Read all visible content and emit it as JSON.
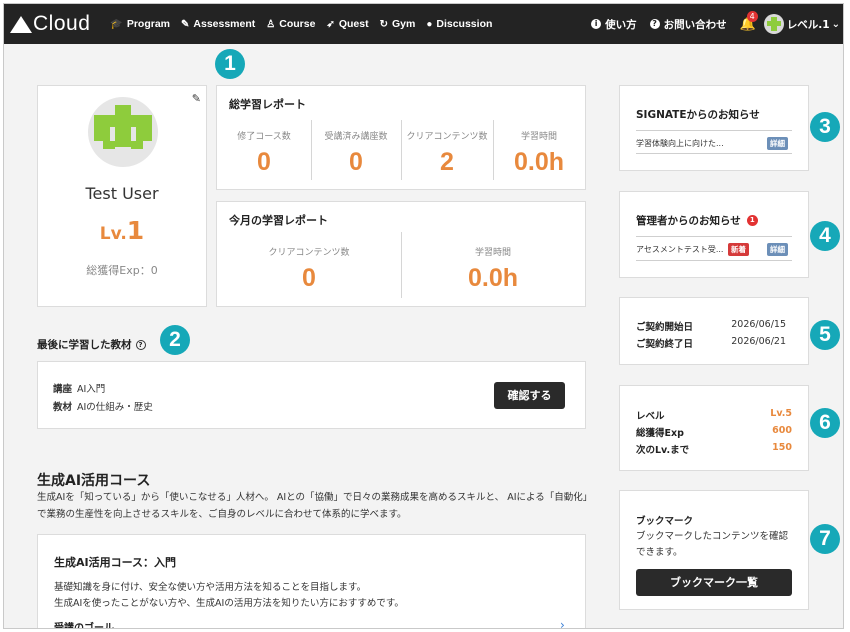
{
  "header": {
    "logo_text": "Cloud",
    "nav": [
      {
        "label": "Program",
        "icon": "graduation-cap-icon"
      },
      {
        "label": "Assessment",
        "icon": "edit-icon"
      },
      {
        "label": "Course",
        "icon": "user-icon"
      },
      {
        "label": "Quest",
        "icon": "rocket-icon"
      },
      {
        "label": "Gym",
        "icon": "fitness-icon"
      },
      {
        "label": "Discussion",
        "icon": "chat-icon"
      }
    ],
    "help_label": "使い方",
    "contact_label": "お問い合わせ",
    "notification_count": "4",
    "user_level": "レベル.1"
  },
  "badges": [
    "1",
    "2",
    "3",
    "4",
    "5",
    "6",
    "7"
  ],
  "profile": {
    "name": "Test User",
    "lv_prefix": "Lv.",
    "lv_value": "1",
    "exp_text": "総獲得Exp：0"
  },
  "total_report": {
    "title": "総学習レポート",
    "stats": [
      {
        "label": "修了コース数",
        "value": "0"
      },
      {
        "label": "受講済み講座数",
        "value": "0"
      },
      {
        "label": "クリアコンテンツ数",
        "value": "2"
      },
      {
        "label": "学習時間",
        "value": "0.0h"
      }
    ]
  },
  "monthly_report": {
    "title": "今月の学習レポート",
    "stats": [
      {
        "label": "クリアコンテンツ数",
        "value": "0"
      },
      {
        "label": "学習時間",
        "value": "0.0h"
      }
    ]
  },
  "last_material": {
    "title": "最後に学習した教材",
    "course_key": "講座",
    "course_value": "AI入門",
    "material_key": "教材",
    "material_value": "AIの仕組み・歴史",
    "button": "確認する"
  },
  "course_section": {
    "title": "生成AI活用コース",
    "desc_line1": "生成AIを「知っている」から「使いこなせる」人材へ。 AIとの「協働」で日々の業務成果を高めるスキルと、 AIによる「自動化」",
    "desc_line2": "で業務の生産性を向上させるスキルを、ご自身のレベルに合わせて体系的に学べます。",
    "card_title": "生成AI活用コース：入門",
    "card_line1": "基礎知識を身に付け、安全な使い方や活用方法を知ることを目指します。",
    "card_line2": "生成AIを使ったことがない方や、生成AIの活用方法を知りたい方におすすめです。",
    "card_goal": "受講のゴール"
  },
  "signate_news": {
    "title": "SIGNATEからのお知らせ",
    "item": "学習体験向上に向けた...",
    "detail": "詳細"
  },
  "admin_news": {
    "title": "管理者からのお知らせ",
    "count": "1",
    "item": "アセスメントテスト受...",
    "new_tag": "新着",
    "detail": "詳細"
  },
  "contract": {
    "start_label": "ご契約開始日",
    "start_value": "2026/06/15",
    "end_label": "ご契約終了日",
    "end_value": "2026/06/21"
  },
  "level_info": {
    "level_label": "レベル",
    "level_value": "Lv.5",
    "exp_label": "総獲得Exp",
    "exp_value": "600",
    "next_label": "次のLv.まで",
    "next_value": "150"
  },
  "bookmark": {
    "title": "ブックマーク",
    "desc_line1": "ブックマークしたコンテンツを確認",
    "desc_line2": "できます。",
    "button": "ブックマーク一覧"
  },
  "colors": {
    "accent_orange": "#e8893d",
    "badge_teal": "#16a8b8",
    "header_bg": "#232323"
  }
}
